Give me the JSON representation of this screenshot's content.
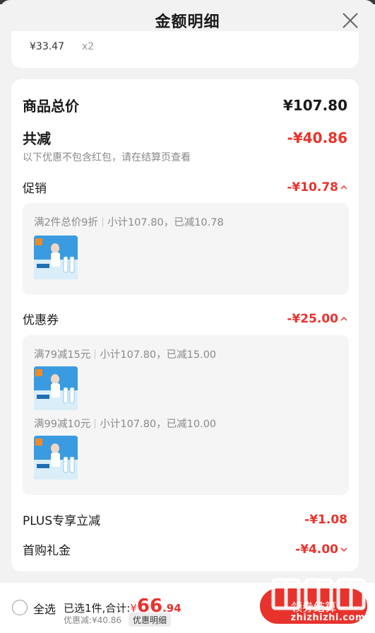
{
  "header": {
    "title": "金额明细"
  },
  "prev_item": {
    "price": "¥33.47",
    "qty": "x2"
  },
  "summary": {
    "total_label": "商品总价",
    "total_value": "¥107.80",
    "reduce_label": "共减",
    "reduce_value": "-¥40.86",
    "note": "以下优惠不包含红包，请在结算页查看"
  },
  "promotion": {
    "label": "促销",
    "value": "-¥10.78",
    "rules": [
      {
        "title": "满2件总价9折",
        "detail": "小计107.80，已减10.78"
      }
    ]
  },
  "coupon": {
    "label": "优惠券",
    "value": "-¥25.00",
    "rules": [
      {
        "title": "满79减15元",
        "detail": "小计107.80，已减15.00"
      },
      {
        "title": "满99减10元",
        "detail": "小计107.80，已减10.00"
      }
    ]
  },
  "plus": {
    "label": "PLUS专享立减",
    "value": "-¥1.08"
  },
  "first_gift": {
    "label": "首购礼金",
    "value": "-¥4.00"
  },
  "bottom": {
    "select_all": "全选",
    "selected_prefix": "已选1件,合计:",
    "currency": "¥",
    "total_int": "66",
    "total_dec": ".94",
    "discount": "优惠减:¥40.86",
    "detail_chip": "优惠明细",
    "checkout": "领券结算"
  },
  "watermark": {
    "text": "zhizhizhi.com"
  },
  "colors": {
    "accent_red": "#e8332d",
    "panel_gray": "#f5f5f5"
  }
}
